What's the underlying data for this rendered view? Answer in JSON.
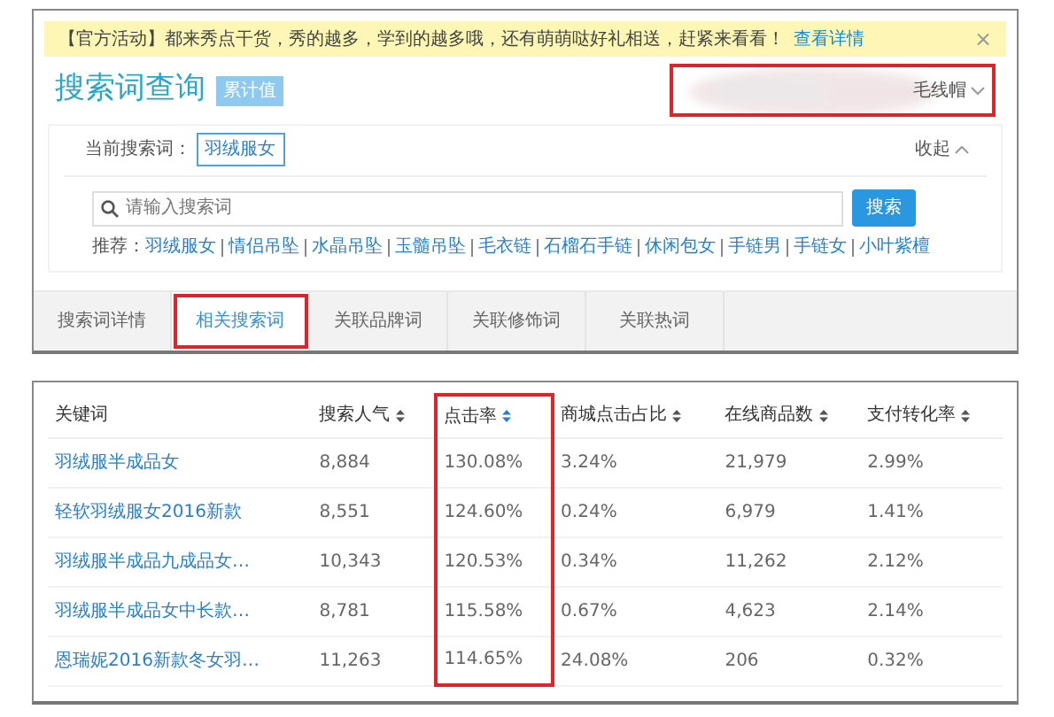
{
  "notice": {
    "text": "【官方活动】都来秀点干货，秀的越多，学到的越多哦，还有萌萌哒好礼相送，赶紧来看看！",
    "link": "查看详情",
    "close": "×"
  },
  "header": {
    "title": "搜索词查询",
    "badge": "累计值",
    "account": {
      "label": "毛线帽",
      "redacted": true,
      "highlighted": true
    }
  },
  "current_search": {
    "label": "当前搜索词：",
    "tag": "羽绒服女",
    "collapse": "收起"
  },
  "search": {
    "placeholder": "请输入搜索词",
    "button": "搜索"
  },
  "recommend": {
    "label": "推荐：",
    "items": [
      "羽绒服女",
      "情侣吊坠",
      "水晶吊坠",
      "玉髓吊坠",
      "毛衣链",
      "石榴石手链",
      "休闲包女",
      "手链男",
      "手链女",
      "小叶紫檀"
    ]
  },
  "tabs": [
    {
      "label": "搜索词详情",
      "selected": false,
      "highlighted": false
    },
    {
      "label": "相关搜索词",
      "selected": true,
      "highlighted": true
    },
    {
      "label": "关联品牌词",
      "selected": false,
      "highlighted": false
    },
    {
      "label": "关联修饰词",
      "selected": false,
      "highlighted": false
    },
    {
      "label": "关联热词",
      "selected": false,
      "highlighted": false
    }
  ],
  "table": {
    "columns": [
      {
        "label": "关键词",
        "sortable": false,
        "highlighted": false
      },
      {
        "label": "搜索人气",
        "sortable": true,
        "sorted": false,
        "highlighted": false
      },
      {
        "label": "点击率",
        "sortable": true,
        "sorted": true,
        "highlighted": true
      },
      {
        "label": "商城点击占比",
        "sortable": true,
        "sorted": false,
        "highlighted": false
      },
      {
        "label": "在线商品数",
        "sortable": true,
        "sorted": false,
        "highlighted": false
      },
      {
        "label": "支付转化率",
        "sortable": true,
        "sorted": false,
        "highlighted": false
      }
    ],
    "rows": [
      [
        "羽绒服半成品女",
        "8,884",
        "130.08%",
        "3.24%",
        "21,979",
        "2.99%"
      ],
      [
        "轻软羽绒服女2016新款",
        "8,551",
        "124.60%",
        "0.24%",
        "6,979",
        "1.41%"
      ],
      [
        "羽绒服半成品九成品女…",
        "10,343",
        "120.53%",
        "0.34%",
        "11,262",
        "2.12%"
      ],
      [
        "羽绒服半成品女中长款…",
        "8,781",
        "115.58%",
        "0.67%",
        "4,623",
        "2.14%"
      ],
      [
        "恩瑞妮2016新款冬女羽…",
        "11,263",
        "114.65%",
        "24.08%",
        "206",
        "0.32%"
      ]
    ]
  }
}
